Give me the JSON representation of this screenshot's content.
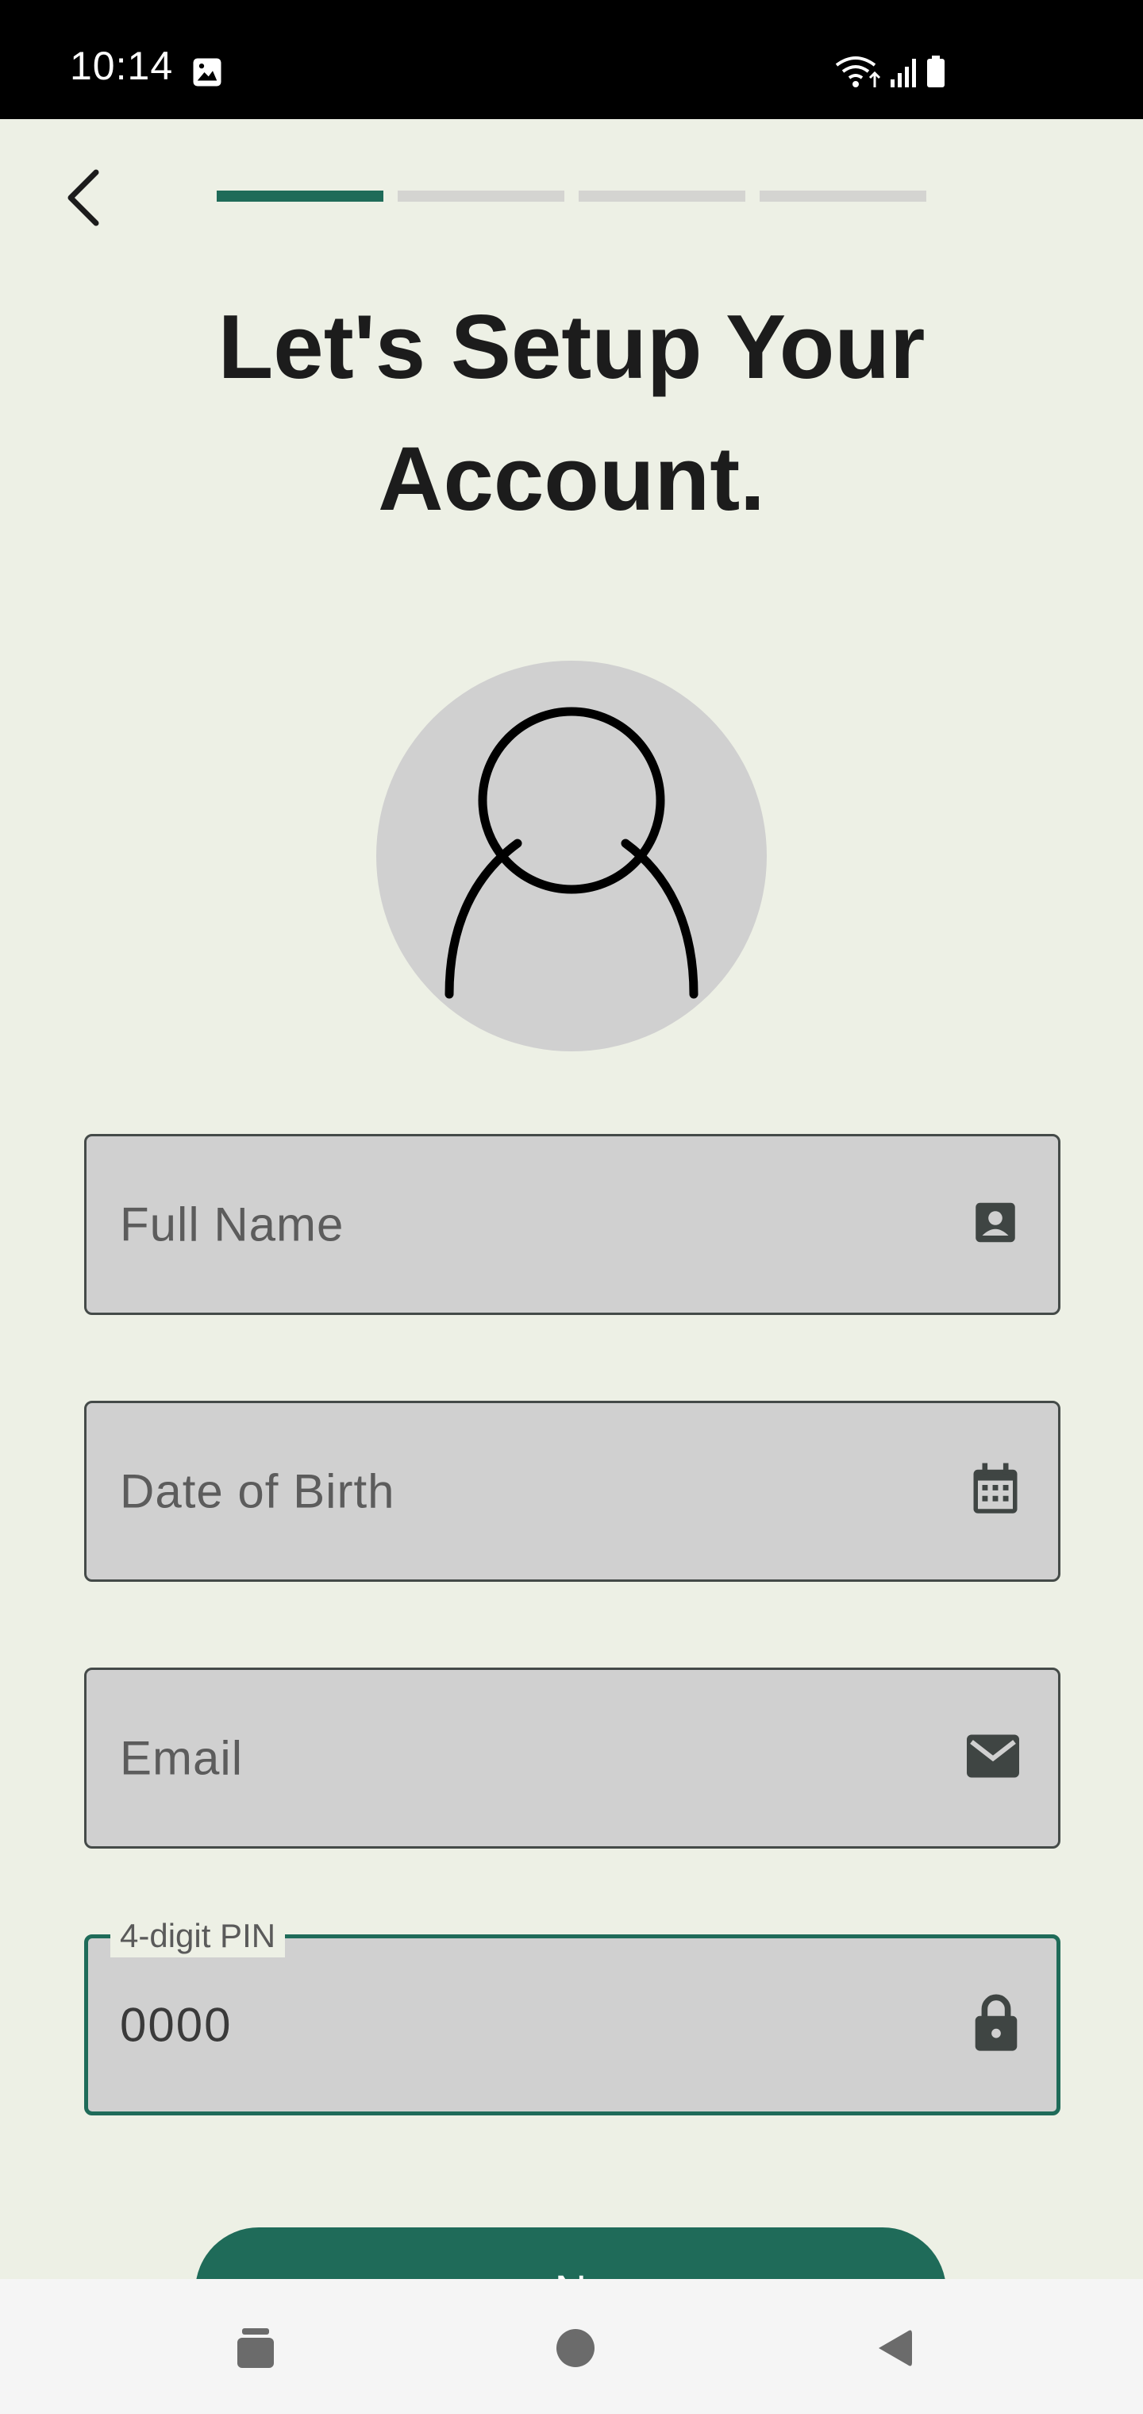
{
  "status_bar": {
    "time": "10:14",
    "icons": [
      "image-notification-icon",
      "wifi-icon",
      "cellular-signal-icon",
      "battery-icon"
    ]
  },
  "header": {
    "back_icon": "chevron-left-icon",
    "progress": {
      "steps_total": 4,
      "current_step": 1
    }
  },
  "title": {
    "line1": "Let's Setup Your",
    "line2": "Account."
  },
  "avatar": {
    "icon": "person-outline-icon"
  },
  "form": {
    "full_name": {
      "placeholder": "Full Name",
      "icon": "contact-card-icon"
    },
    "date_of_birth": {
      "placeholder": "Date of Birth",
      "icon": "calendar-icon"
    },
    "email": {
      "placeholder": "Email",
      "icon": "mail-icon"
    },
    "pin": {
      "label": "4-digit PIN",
      "value": "0000",
      "icon": "lock-icon"
    }
  },
  "next_button": {
    "label": "N"
  },
  "nav_bar": {
    "recents_icon": "recents-icon",
    "home_icon": "home-icon",
    "back_icon": "back-triangle-icon"
  },
  "colors": {
    "background": "#edf0e5",
    "accent": "#1f6b59",
    "field_fill": "#d0d0d0",
    "field_border": "#444a48",
    "progress_inactive": "#d4d4d1"
  }
}
